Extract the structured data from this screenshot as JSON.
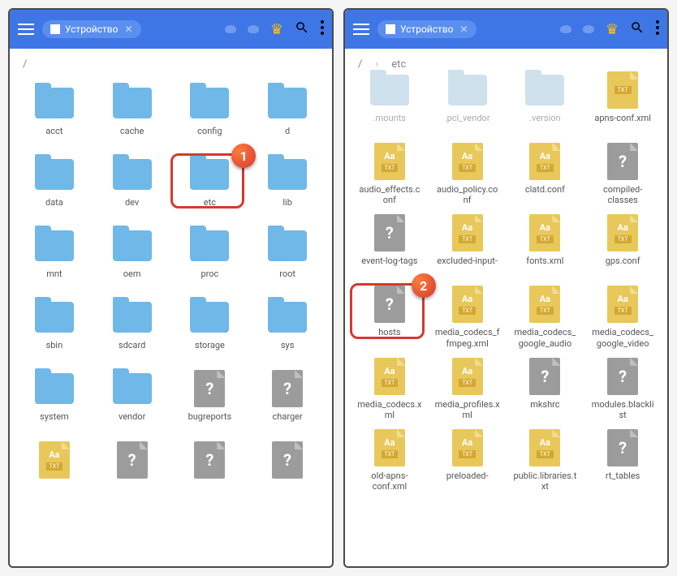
{
  "left": {
    "tab_label": "Устройство",
    "breadcrumb": [
      "/"
    ],
    "items": [
      {
        "name": "acct",
        "type": "folder"
      },
      {
        "name": "cache",
        "type": "folder"
      },
      {
        "name": "config",
        "type": "folder"
      },
      {
        "name": "d",
        "type": "folder"
      },
      {
        "name": "data",
        "type": "folder"
      },
      {
        "name": "dev",
        "type": "folder"
      },
      {
        "name": "etc",
        "type": "folder"
      },
      {
        "name": "lib",
        "type": "folder"
      },
      {
        "name": "mnt",
        "type": "folder"
      },
      {
        "name": "oem",
        "type": "folder"
      },
      {
        "name": "proc",
        "type": "folder"
      },
      {
        "name": "root",
        "type": "folder"
      },
      {
        "name": "sbin",
        "type": "folder"
      },
      {
        "name": "sdcard",
        "type": "folder"
      },
      {
        "name": "storage",
        "type": "folder"
      },
      {
        "name": "sys",
        "type": "folder"
      },
      {
        "name": "system",
        "type": "folder"
      },
      {
        "name": "vendor",
        "type": "folder"
      },
      {
        "name": "bugreports",
        "type": "unknown"
      },
      {
        "name": "charger",
        "type": "unknown"
      },
      {
        "name": "",
        "type": "txt"
      },
      {
        "name": "",
        "type": "unknown"
      },
      {
        "name": "",
        "type": "unknown"
      },
      {
        "name": "",
        "type": "unknown"
      }
    ],
    "callout": {
      "index": 6,
      "number": "1"
    }
  },
  "right": {
    "tab_label": "Устройство",
    "breadcrumb": [
      "/",
      "etc"
    ],
    "items": [
      {
        "name": ".mounts",
        "type": "folder",
        "faded": true
      },
      {
        "name": ".pci_vendor",
        "type": "folder",
        "faded": true
      },
      {
        "name": ".version",
        "type": "folder",
        "faded": true
      },
      {
        "name": "apns-conf.xml",
        "type": "txt-simple"
      },
      {
        "name": "audio_effects.conf",
        "type": "txt"
      },
      {
        "name": "audio_policy.conf",
        "type": "txt"
      },
      {
        "name": "clatd.conf",
        "type": "txt"
      },
      {
        "name": "compiled-classes",
        "type": "unknown"
      },
      {
        "name": "event-log-tags",
        "type": "unknown"
      },
      {
        "name": "excluded-input-",
        "type": "txt"
      },
      {
        "name": "fonts.xml",
        "type": "txt"
      },
      {
        "name": "gps.conf",
        "type": "txt"
      },
      {
        "name": "hosts",
        "type": "unknown"
      },
      {
        "name": "media_codecs_ffmpeg.xml",
        "type": "txt"
      },
      {
        "name": "media_codecs_google_audio",
        "type": "txt"
      },
      {
        "name": "media_codecs_google_video",
        "type": "txt"
      },
      {
        "name": "media_codecs.xml",
        "type": "txt"
      },
      {
        "name": "media_profiles.xml",
        "type": "txt"
      },
      {
        "name": "mkshrc",
        "type": "unknown"
      },
      {
        "name": "modules.blacklist",
        "type": "unknown"
      },
      {
        "name": "old-apns-conf.xml",
        "type": "txt"
      },
      {
        "name": "preloaded-",
        "type": "txt"
      },
      {
        "name": "public.libraries.txt",
        "type": "txt"
      },
      {
        "name": "rt_tables",
        "type": "unknown"
      }
    ],
    "callout": {
      "index": 12,
      "number": "2"
    }
  },
  "aa_text": "Aa",
  "txt_text": "TXT",
  "q_text": "?"
}
